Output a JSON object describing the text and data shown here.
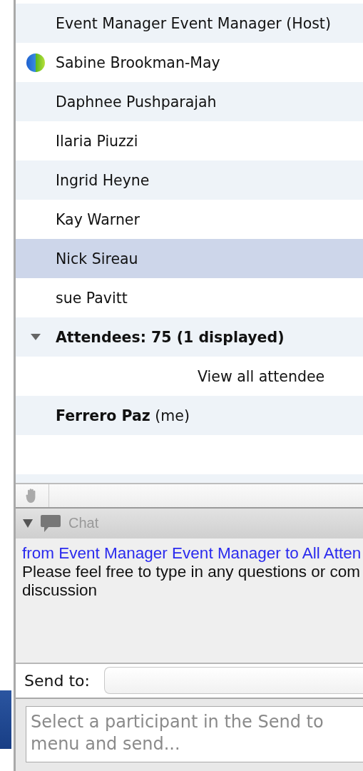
{
  "participants": [
    {
      "kind": "person",
      "name": "Event Manager Event Manager (Host)",
      "status": false,
      "selected": false
    },
    {
      "kind": "person",
      "name": "Sabine Brookman-May",
      "status": true,
      "selected": false
    },
    {
      "kind": "person",
      "name": "Daphnee Pushparajah",
      "status": false,
      "selected": false
    },
    {
      "kind": "person",
      "name": "Ilaria Piuzzi",
      "status": false,
      "selected": false
    },
    {
      "kind": "person",
      "name": "Ingrid Heyne",
      "status": false,
      "selected": false
    },
    {
      "kind": "person",
      "name": "Kay Warner",
      "status": false,
      "selected": false
    },
    {
      "kind": "person",
      "name": "Nick Sireau",
      "status": false,
      "selected": true
    },
    {
      "kind": "person",
      "name": "sue Pavitt",
      "status": false,
      "selected": false
    },
    {
      "kind": "group",
      "name": "Attendees: 75 (1 displayed)",
      "expanded": true
    },
    {
      "kind": "link",
      "name": "View all attendee"
    },
    {
      "kind": "person",
      "name": "**Ferrero Paz** (me)",
      "status": false,
      "selected": false
    }
  ],
  "chat": {
    "title": "Chat",
    "expanded": true,
    "messages": [
      {
        "header": "from Event Manager Event Manager to All Atten",
        "body": "Please feel free to type in any questions or com\ndiscussion"
      }
    ],
    "send_to_label": "Send to:",
    "input": {
      "placeholder": "Select a participant in the Send to menu and send..."
    }
  }
}
